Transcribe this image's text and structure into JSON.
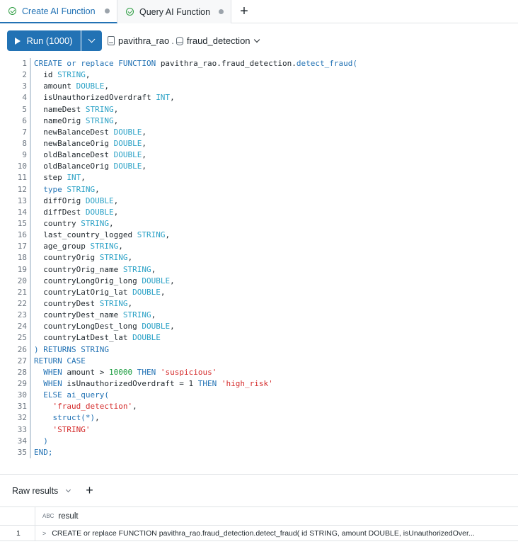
{
  "tabs": [
    {
      "label": "Create AI Function",
      "active": true
    },
    {
      "label": "Query AI Function",
      "active": false
    }
  ],
  "toolbar": {
    "run_label": "Run (1000)",
    "catalog": "pavithra_rao",
    "separator": ".",
    "schema": "fraud_detection"
  },
  "editor": {
    "lines": [
      [
        {
          "t": "CREATE or replace FUNCTION ",
          "c": "kw"
        },
        {
          "t": "pavithra_rao.fraud_detection.",
          "c": ""
        },
        {
          "t": "detect_fraud(",
          "c": "fn"
        }
      ],
      [
        {
          "t": "  id ",
          "c": ""
        },
        {
          "t": "STRING",
          "c": "ty"
        },
        {
          "t": ",",
          "c": ""
        }
      ],
      [
        {
          "t": "  amount ",
          "c": ""
        },
        {
          "t": "DOUBLE",
          "c": "ty"
        },
        {
          "t": ",",
          "c": ""
        }
      ],
      [
        {
          "t": "  isUnauthorizedOverdraft ",
          "c": ""
        },
        {
          "t": "INT",
          "c": "ty"
        },
        {
          "t": ",",
          "c": ""
        }
      ],
      [
        {
          "t": "  nameDest ",
          "c": ""
        },
        {
          "t": "STRING",
          "c": "ty"
        },
        {
          "t": ",",
          "c": ""
        }
      ],
      [
        {
          "t": "  nameOrig ",
          "c": ""
        },
        {
          "t": "STRING",
          "c": "ty"
        },
        {
          "t": ",",
          "c": ""
        }
      ],
      [
        {
          "t": "  newBalanceDest ",
          "c": ""
        },
        {
          "t": "DOUBLE",
          "c": "ty"
        },
        {
          "t": ",",
          "c": ""
        }
      ],
      [
        {
          "t": "  newBalanceOrig ",
          "c": ""
        },
        {
          "t": "DOUBLE",
          "c": "ty"
        },
        {
          "t": ",",
          "c": ""
        }
      ],
      [
        {
          "t": "  oldBalanceDest ",
          "c": ""
        },
        {
          "t": "DOUBLE",
          "c": "ty"
        },
        {
          "t": ",",
          "c": ""
        }
      ],
      [
        {
          "t": "  oldBalanceOrig ",
          "c": ""
        },
        {
          "t": "DOUBLE",
          "c": "ty"
        },
        {
          "t": ",",
          "c": ""
        }
      ],
      [
        {
          "t": "  step ",
          "c": ""
        },
        {
          "t": "INT",
          "c": "ty"
        },
        {
          "t": ",",
          "c": ""
        }
      ],
      [
        {
          "t": "  type ",
          "c": "kw"
        },
        {
          "t": "STRING",
          "c": "ty"
        },
        {
          "t": ",",
          "c": ""
        }
      ],
      [
        {
          "t": "  diffOrig ",
          "c": ""
        },
        {
          "t": "DOUBLE",
          "c": "ty"
        },
        {
          "t": ",",
          "c": ""
        }
      ],
      [
        {
          "t": "  diffDest ",
          "c": ""
        },
        {
          "t": "DOUBLE",
          "c": "ty"
        },
        {
          "t": ",",
          "c": ""
        }
      ],
      [
        {
          "t": "  country ",
          "c": ""
        },
        {
          "t": "STRING",
          "c": "ty"
        },
        {
          "t": ",",
          "c": ""
        }
      ],
      [
        {
          "t": "  last_country_logged ",
          "c": ""
        },
        {
          "t": "STRING",
          "c": "ty"
        },
        {
          "t": ",",
          "c": ""
        }
      ],
      [
        {
          "t": "  age_group ",
          "c": ""
        },
        {
          "t": "STRING",
          "c": "ty"
        },
        {
          "t": ",",
          "c": ""
        }
      ],
      [
        {
          "t": "  countryOrig ",
          "c": ""
        },
        {
          "t": "STRING",
          "c": "ty"
        },
        {
          "t": ",",
          "c": ""
        }
      ],
      [
        {
          "t": "  countryOrig_name ",
          "c": ""
        },
        {
          "t": "STRING",
          "c": "ty"
        },
        {
          "t": ",",
          "c": ""
        }
      ],
      [
        {
          "t": "  countryLongOrig_long ",
          "c": ""
        },
        {
          "t": "DOUBLE",
          "c": "ty"
        },
        {
          "t": ",",
          "c": ""
        }
      ],
      [
        {
          "t": "  countryLatOrig_lat ",
          "c": ""
        },
        {
          "t": "DOUBLE",
          "c": "ty"
        },
        {
          "t": ",",
          "c": ""
        }
      ],
      [
        {
          "t": "  countryDest ",
          "c": ""
        },
        {
          "t": "STRING",
          "c": "ty"
        },
        {
          "t": ",",
          "c": ""
        }
      ],
      [
        {
          "t": "  countryDest_name ",
          "c": ""
        },
        {
          "t": "STRING",
          "c": "ty"
        },
        {
          "t": ",",
          "c": ""
        }
      ],
      [
        {
          "t": "  countryLongDest_long ",
          "c": ""
        },
        {
          "t": "DOUBLE",
          "c": "ty"
        },
        {
          "t": ",",
          "c": ""
        }
      ],
      [
        {
          "t": "  countryLatDest_lat ",
          "c": ""
        },
        {
          "t": "DOUBLE",
          "c": "ty"
        }
      ],
      [
        {
          "t": ") RETURNS STRING",
          "c": "kw"
        }
      ],
      [
        {
          "t": "RETURN CASE",
          "c": "kw"
        }
      ],
      [
        {
          "t": "  WHEN ",
          "c": "kw"
        },
        {
          "t": "amount > ",
          "c": ""
        },
        {
          "t": "10000",
          "c": "num"
        },
        {
          "t": " THEN ",
          "c": "kw"
        },
        {
          "t": "'suspicious'",
          "c": "str"
        }
      ],
      [
        {
          "t": "  WHEN ",
          "c": "kw"
        },
        {
          "t": "isUnauthorizedOverdraft = ",
          "c": ""
        },
        {
          "t": "1",
          "c": ""
        },
        {
          "t": " THEN ",
          "c": "kw"
        },
        {
          "t": "'high_risk'",
          "c": "str"
        }
      ],
      [
        {
          "t": "  ELSE ",
          "c": "kw"
        },
        {
          "t": "ai_query(",
          "c": "fn"
        }
      ],
      [
        {
          "t": "    'fraud_detection'",
          "c": "str"
        },
        {
          "t": ",",
          "c": ""
        }
      ],
      [
        {
          "t": "    struct(*)",
          "c": "fn"
        },
        {
          "t": ",",
          "c": ""
        }
      ],
      [
        {
          "t": "    'STRING'",
          "c": "str"
        }
      ],
      [
        {
          "t": "  )",
          "c": "kw"
        }
      ],
      [
        {
          "t": "END;",
          "c": "kw"
        }
      ]
    ]
  },
  "results": {
    "tab_label": "Raw results",
    "column_header": "result",
    "type_icon": "ABC",
    "rows": [
      {
        "num": "1",
        "value": "CREATE or replace FUNCTION pavithra_rao.fraud_detection.detect_fraud( id STRING, amount DOUBLE, isUnauthorizedOver..."
      }
    ]
  }
}
